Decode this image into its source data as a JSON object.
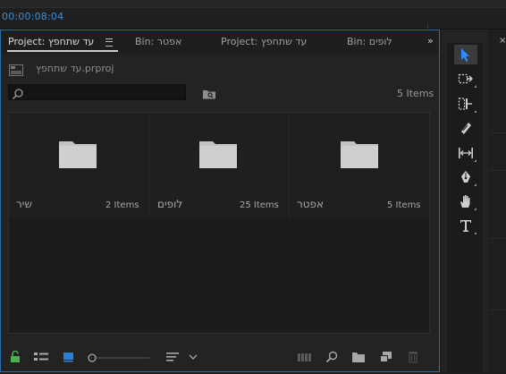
{
  "timecode": "00:00:08:04",
  "tabs": [
    {
      "label": "Project: עד שתחפץ",
      "active": true
    },
    {
      "label": "Bin: אפטר",
      "active": false
    },
    {
      "label": "Project: עד שתחפץ",
      "active": false
    },
    {
      "label": "Bin: לופים",
      "active": false
    }
  ],
  "overflow_label": "»",
  "project_file": "עד שתחפץ.prproj",
  "search": {
    "value": "",
    "placeholder": ""
  },
  "item_count": "5 Items",
  "bins": [
    {
      "name": "שיר",
      "count": "2 Items"
    },
    {
      "name": "לופים",
      "count": "25 Items"
    },
    {
      "name": "אפטר",
      "count": "5 Items"
    }
  ],
  "tools": [
    "selection-tool",
    "track-select-tool",
    "ripple-edit-tool",
    "razor-tool",
    "slip-tool",
    "pen-tool",
    "hand-tool",
    "type-tool"
  ],
  "right_panel_close": "×",
  "colors": {
    "accent": "#3a8fd6",
    "lock": "#4caf50",
    "panel_border": "#2a6fb0"
  }
}
